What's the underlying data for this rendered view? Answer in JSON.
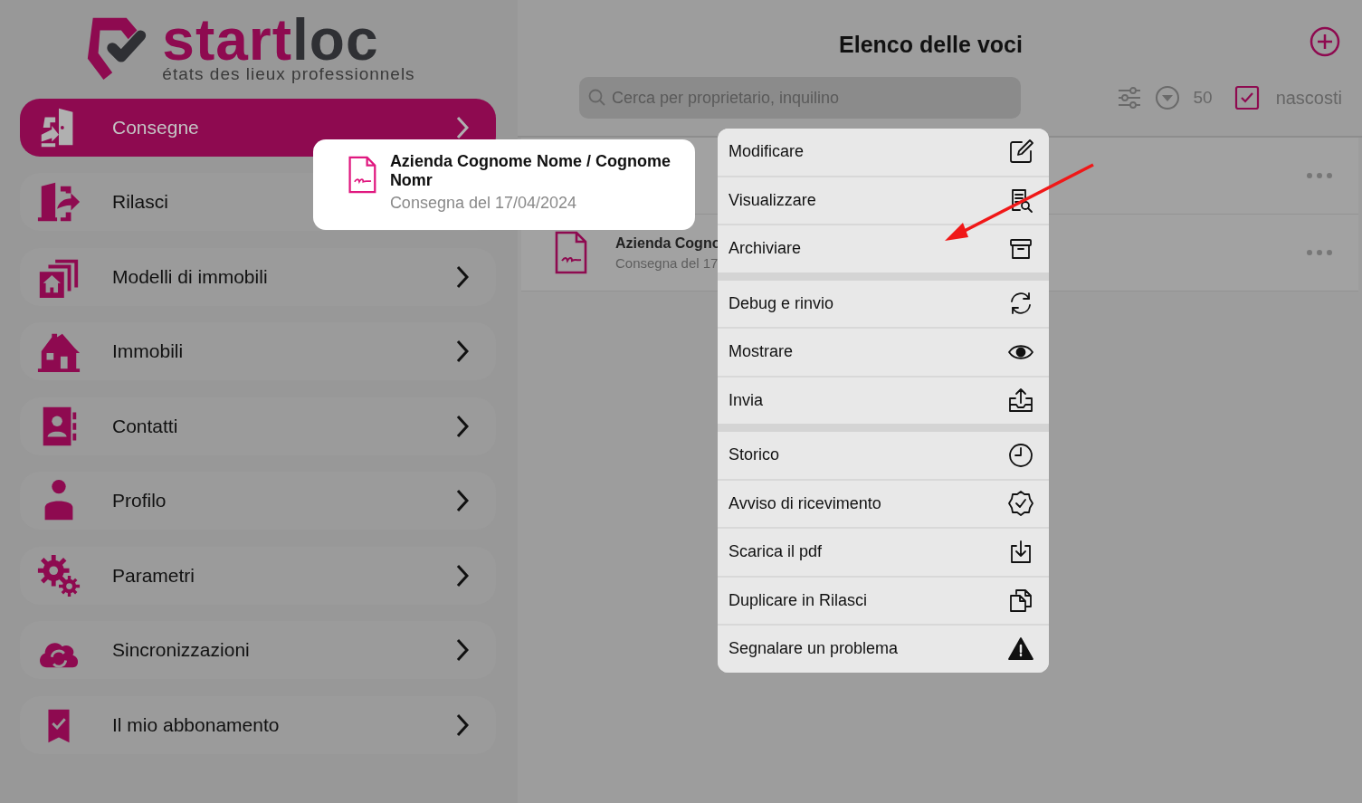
{
  "logo": {
    "name_start": "start",
    "name_end": "loc",
    "tagline": "états des lieux professionnels"
  },
  "sidebar": {
    "items": [
      {
        "label": "Consegne",
        "selected": true,
        "chevron": true
      },
      {
        "label": "Rilasci",
        "selected": false,
        "chevron": false
      },
      {
        "label": "Modelli di immobili",
        "selected": false,
        "chevron": true
      },
      {
        "label": "Immobili",
        "selected": false,
        "chevron": true
      },
      {
        "label": "Contatti",
        "selected": false,
        "chevron": true
      },
      {
        "label": "Profilo",
        "selected": false,
        "chevron": true
      },
      {
        "label": "Parametri",
        "selected": false,
        "chevron": true
      },
      {
        "label": "Sincronizzazioni",
        "selected": false,
        "chevron": true
      },
      {
        "label": "Il mio abbonamento",
        "selected": false,
        "chevron": true
      }
    ]
  },
  "header": {
    "title": "Elenco delle voci"
  },
  "search": {
    "placeholder": "Cerca per proprietario, inquilino"
  },
  "toolbar": {
    "count": "50",
    "hidden_label": "nascosti",
    "hidden_checked": true
  },
  "list": {
    "rows": [
      {},
      {
        "title": "Azienda Cogno",
        "subtitle": "Consegna del 17"
      }
    ]
  },
  "popup_card": {
    "title": "Azienda Cognome Nome / Cognome Nomr",
    "subtitle": "Consegna del 17/04/2024"
  },
  "context_menu": {
    "groups": [
      {
        "items": [
          "Modificare",
          "Visualizzare",
          "Archiviare"
        ]
      },
      {
        "items": [
          "Debug e rinvio",
          "Mostrare",
          "Invia"
        ]
      },
      {
        "items": [
          "Storico",
          "Avviso di ricevimento",
          "Scarica il pdf",
          "Duplicare in Rilasci",
          "Segnalare un problema"
        ]
      }
    ]
  },
  "annotation": {
    "kind": "arrow"
  }
}
